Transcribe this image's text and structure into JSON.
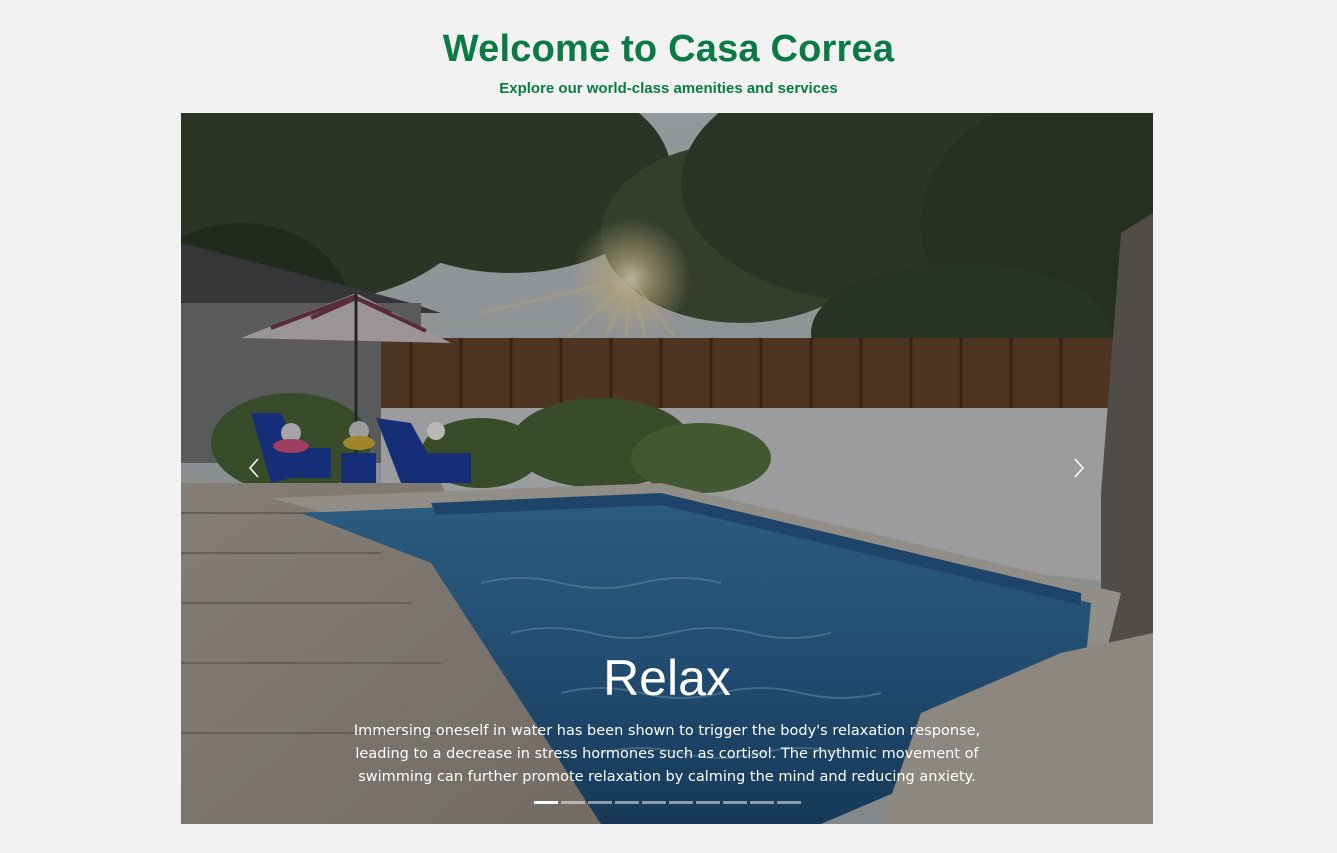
{
  "header": {
    "title": "Welcome to Casa Correa",
    "subtitle": "Explore our world-class amenities and services"
  },
  "carousel": {
    "active_index": 0,
    "slide_count": 10,
    "slide": {
      "title": "Relax",
      "text": "Immersing oneself in water has been shown to trigger the body's relaxation response, leading to a decrease in stress hormones such as cortisol. The rhythmic movement of swimming can further promote relaxation by calming the mind and reducing anxiety."
    },
    "prev_icon": "chevron-left-icon",
    "next_icon": "chevron-right-icon"
  },
  "colors": {
    "brand_green": "#0b7a45",
    "page_background": "#f2f2f2"
  }
}
